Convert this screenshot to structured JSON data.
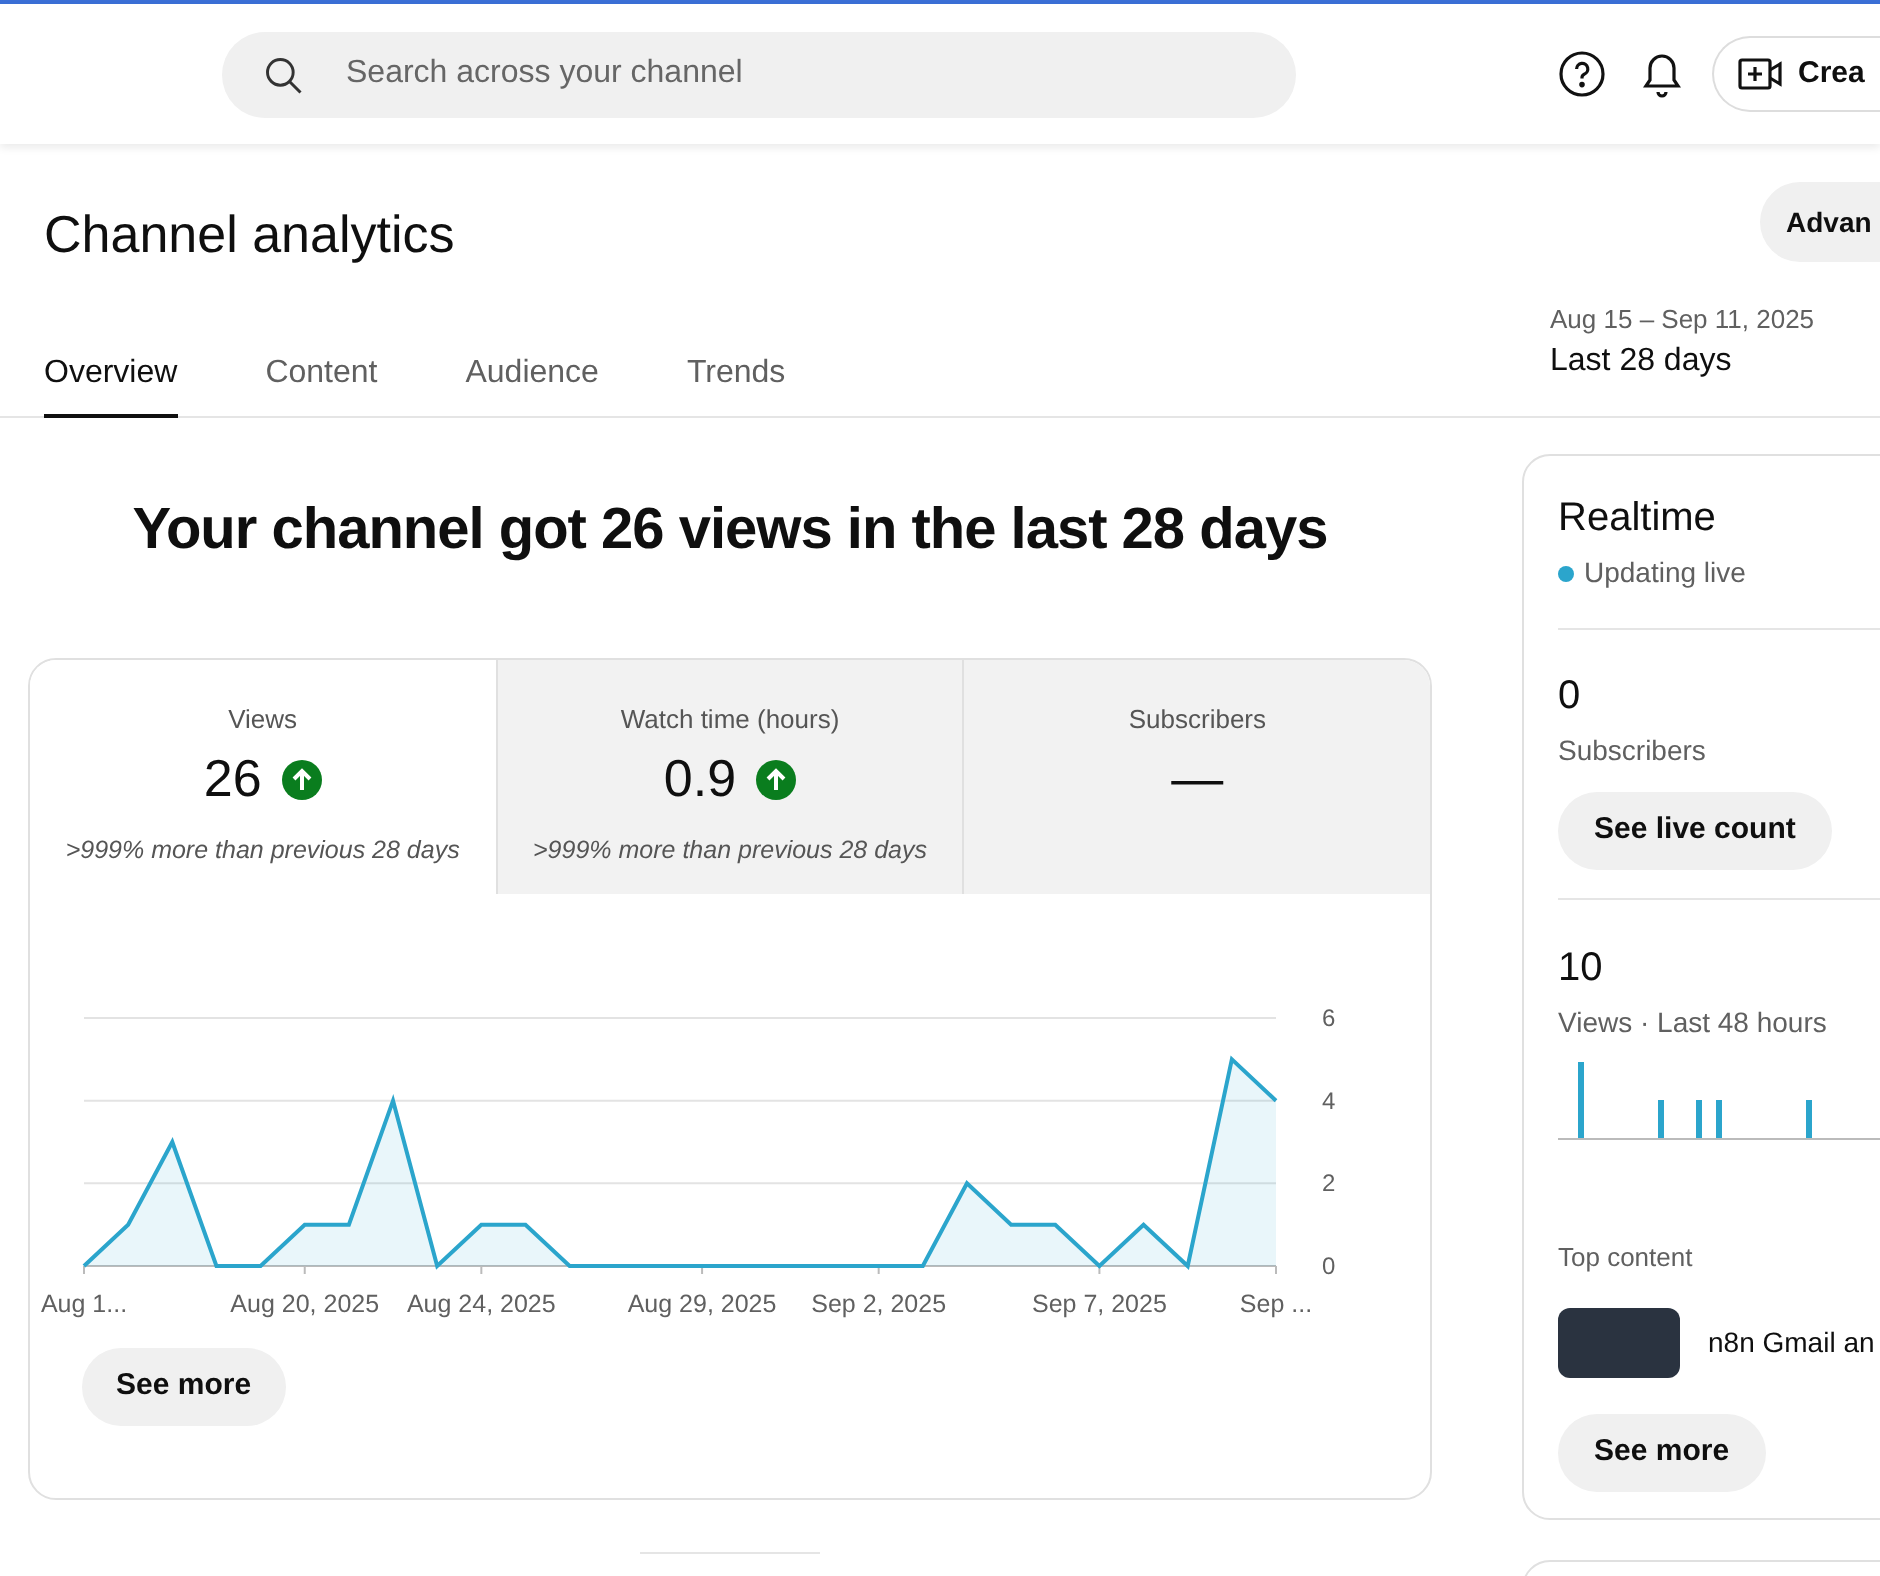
{
  "topbar": {
    "search": {
      "placeholder": "Search across your channel"
    },
    "create_button": "Crea"
  },
  "header": {
    "title": "Channel analytics",
    "advanced_button": "Advan",
    "date_range": "Aug 15 – Sep 11, 2025",
    "period": "Last 28 days"
  },
  "tabs": [
    {
      "label": "Overview",
      "selected": true
    },
    {
      "label": "Content",
      "selected": false
    },
    {
      "label": "Audience",
      "selected": false
    },
    {
      "label": "Trends",
      "selected": false
    }
  ],
  "headline": "Your channel got 26 views in the last 28 days",
  "metrics": [
    {
      "label": "Views",
      "value": "26",
      "rising": true,
      "comparison": ">999% more than previous 28 days",
      "selected": true
    },
    {
      "label": "Watch time (hours)",
      "value": "0.9",
      "rising": true,
      "comparison": ">999% more than previous 28 days",
      "selected": false
    },
    {
      "label": "Subscribers",
      "value": "—",
      "rising": false,
      "selected": false
    }
  ],
  "chart_data": {
    "type": "area",
    "categories": [
      "Aug 1...",
      null,
      null,
      null,
      null,
      "Aug 20, 2025",
      null,
      null,
      null,
      "Aug 24, 2025",
      null,
      null,
      null,
      null,
      "Aug 29, 2025",
      null,
      null,
      null,
      "Sep 2, 2025",
      null,
      null,
      null,
      null,
      "Sep 7, 2025",
      null,
      null,
      null,
      "Sep ..."
    ],
    "values": [
      0,
      1,
      3,
      0,
      0,
      1,
      1,
      4,
      0,
      1,
      1,
      0,
      0,
      0,
      0,
      0,
      0,
      0,
      0,
      0,
      2,
      1,
      1,
      0,
      1,
      0,
      5,
      4
    ],
    "ylim": [
      0,
      6
    ],
    "yticks": [
      0,
      2,
      4,
      6
    ]
  },
  "see_more_button": "See more",
  "realtime": {
    "title": "Realtime",
    "status": "Updating live",
    "subscribers_value": "0",
    "subscribers_label": "Subscribers",
    "live_count_button": "See live count",
    "views_value": "10",
    "views_label": "Views · Last 48 hours",
    "top_content_label": "Top content",
    "top_content_title": "n8n Gmail an",
    "see_more_button": "See more"
  }
}
